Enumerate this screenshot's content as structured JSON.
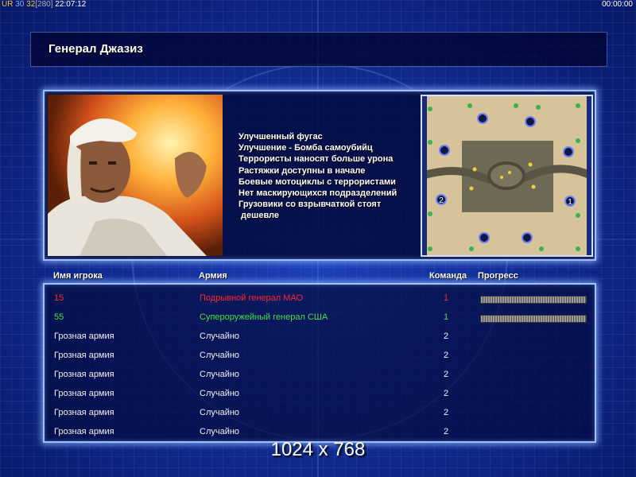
{
  "topbar": {
    "fps_1": "UR",
    "fps_2": "30",
    "fps_3": "32",
    "fps_4": "[280]",
    "clock": "22:07:12",
    "timer": "00:00:00"
  },
  "header": {
    "title": "Генерал Джазиз"
  },
  "perks": [
    "Улучшенный фугас",
    "Улучшение - Бомба самоубийц",
    "Террористы наносят больше урона",
    "Растяжки доступны в начале",
    "Боевые мотоциклы с террористами",
    "Нет маскирующихся подразделений",
    "Грузовики со взрывчаткой стоят",
    " дешевле"
  ],
  "map": {
    "slot_left": "2",
    "slot_right": "1"
  },
  "table": {
    "headers": {
      "name": "Имя игрока",
      "army": "Армия",
      "team": "Команда",
      "progress": "Прогресс"
    },
    "rows": [
      {
        "name": "15",
        "army": "Подрывной генерал МАО",
        "team": "1",
        "color": "red",
        "has_progress": true
      },
      {
        "name": "55",
        "army": "Супероружейный генерал США",
        "team": "1",
        "color": "green",
        "has_progress": true
      },
      {
        "name": "Грозная армия",
        "army": "Случайно",
        "team": "2",
        "color": "white",
        "has_progress": false
      },
      {
        "name": "Грозная армия",
        "army": "Случайно",
        "team": "2",
        "color": "white",
        "has_progress": false
      },
      {
        "name": "Грозная армия",
        "army": "Случайно",
        "team": "2",
        "color": "white",
        "has_progress": false
      },
      {
        "name": "Грозная армия",
        "army": "Случайно",
        "team": "2",
        "color": "white",
        "has_progress": false
      },
      {
        "name": "Грозная армия",
        "army": "Случайно",
        "team": "2",
        "color": "white",
        "has_progress": false
      },
      {
        "name": "Грозная армия",
        "army": "Случайно",
        "team": "2",
        "color": "white",
        "has_progress": false
      }
    ]
  },
  "resolution": "1024 x 768"
}
